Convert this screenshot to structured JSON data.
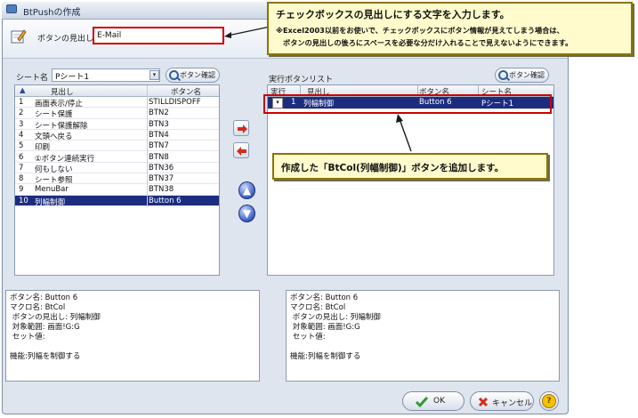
{
  "window": {
    "title": "BtPushの作成"
  },
  "header": {
    "caption_label": "ボタンの見出し",
    "caption_value": "E-Mail"
  },
  "left": {
    "sheet_label": "シート名",
    "sheet_value": "Pシート1",
    "confirm_label": "ボタン確認",
    "columns": [
      "",
      "見出し",
      "ボタン名"
    ],
    "rows": [
      {
        "no": "1",
        "caption": "画面表示/停止",
        "name": "STILLDISPOFF"
      },
      {
        "no": "2",
        "caption": "シート保護",
        "name": "BTN2"
      },
      {
        "no": "3",
        "caption": "シート保護解除",
        "name": "BTN3"
      },
      {
        "no": "4",
        "caption": "文頭へ戻る",
        "name": "BTN4"
      },
      {
        "no": "5",
        "caption": "印刷",
        "name": "BTN7"
      },
      {
        "no": "6",
        "caption": "①ボタン連続実行",
        "name": "BTN8"
      },
      {
        "no": "7",
        "caption": "何もしない",
        "name": "BTN36"
      },
      {
        "no": "8",
        "caption": "シート参照",
        "name": "BTN37"
      },
      {
        "no": "9",
        "caption": "MenuBar",
        "name": "BTN38"
      },
      {
        "no": "10",
        "caption": "列幅制御",
        "name": "Button 6"
      }
    ],
    "selected_index": 9
  },
  "right": {
    "list_label": "実行ボタンリスト",
    "confirm_label": "ボタン確認",
    "columns": [
      "実行",
      "見出し",
      "ボタン名",
      "シート名"
    ],
    "rows": [
      {
        "exec": "▾",
        "no": "1",
        "caption": "列幅制御",
        "name": "Button 6",
        "sheet": "Pシート1"
      }
    ]
  },
  "desc_left": "ボタン名: Button 6\nマクロ名: BtCol\n ボタンの見出し: 列幅制御\n 対象範囲: 画面!G:G\n セット値:\n\n機能:列幅を制御する",
  "desc_right": "ボタン名: Button 6\nマクロ名: BtCol\n ボタンの見出し: 列幅制御\n 対象範囲: 画面!G:G\n セット値:\n\n機能:列幅を制御する",
  "footer": {
    "ok_label": "OK",
    "cancel_label": "キャンセル",
    "help_label": "?"
  },
  "callout_top": {
    "line1": "チェックボックスの見出しにする文字を入力します。",
    "line2": "※Excel2003以前をお使いで、チェックボックスにボタン情報が見えてしまう場合は、",
    "line3": "ボタンの見出しの後ろにスペースを必要な分だけ入れることで見えないようにできます。"
  },
  "callout_mid": {
    "text": "作成した「BtCol(列幅制御)」ボタンを追加します。"
  },
  "icons": [
    "edit-icon",
    "magnifier-icon",
    "sort-up-icon",
    "dropdown-icon",
    "arrow-right-icon",
    "arrow-left-icon",
    "move-up-icon",
    "move-down-icon",
    "check-icon",
    "cancel-icon",
    "help-icon"
  ],
  "colors": {
    "selection": "#1c2d80",
    "highlight_red": "#cc0000",
    "callout_fill": "#fffbcc"
  }
}
